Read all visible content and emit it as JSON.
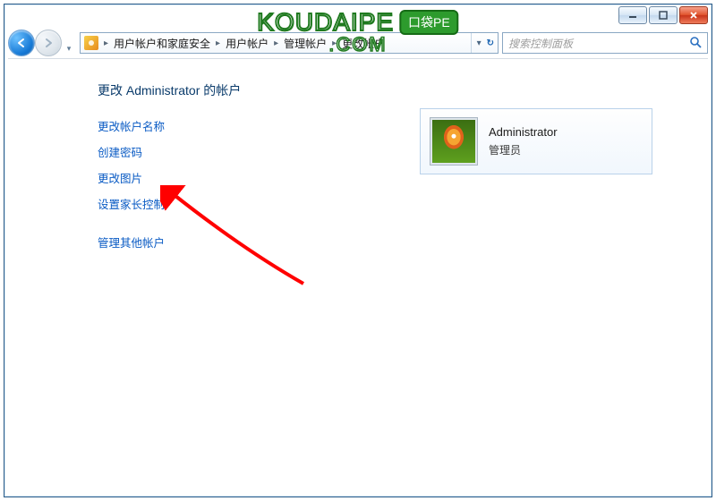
{
  "window_controls": {
    "minimize_label": "_",
    "maximize_label": "▢",
    "close_label": "✕"
  },
  "breadcrumb": {
    "items": [
      "用户帐户和家庭安全",
      "用户帐户",
      "管理帐户",
      "更改帐户"
    ],
    "separator": "▸"
  },
  "search": {
    "placeholder": "搜索控制面板"
  },
  "page": {
    "title": "更改 Administrator 的帐户"
  },
  "tasks": [
    "更改帐户名称",
    "创建密码",
    "更改图片",
    "设置家长控制",
    "管理其他帐户"
  ],
  "account": {
    "name": "Administrator",
    "role": "管理员"
  },
  "watermark": {
    "main": "KOUDAIPE",
    "badge": "口袋PE",
    "sub": ".COM"
  },
  "colors": {
    "link": "#0a5bc4",
    "titlebar_border": "#2b5c87",
    "arrow": "#ff0000"
  }
}
